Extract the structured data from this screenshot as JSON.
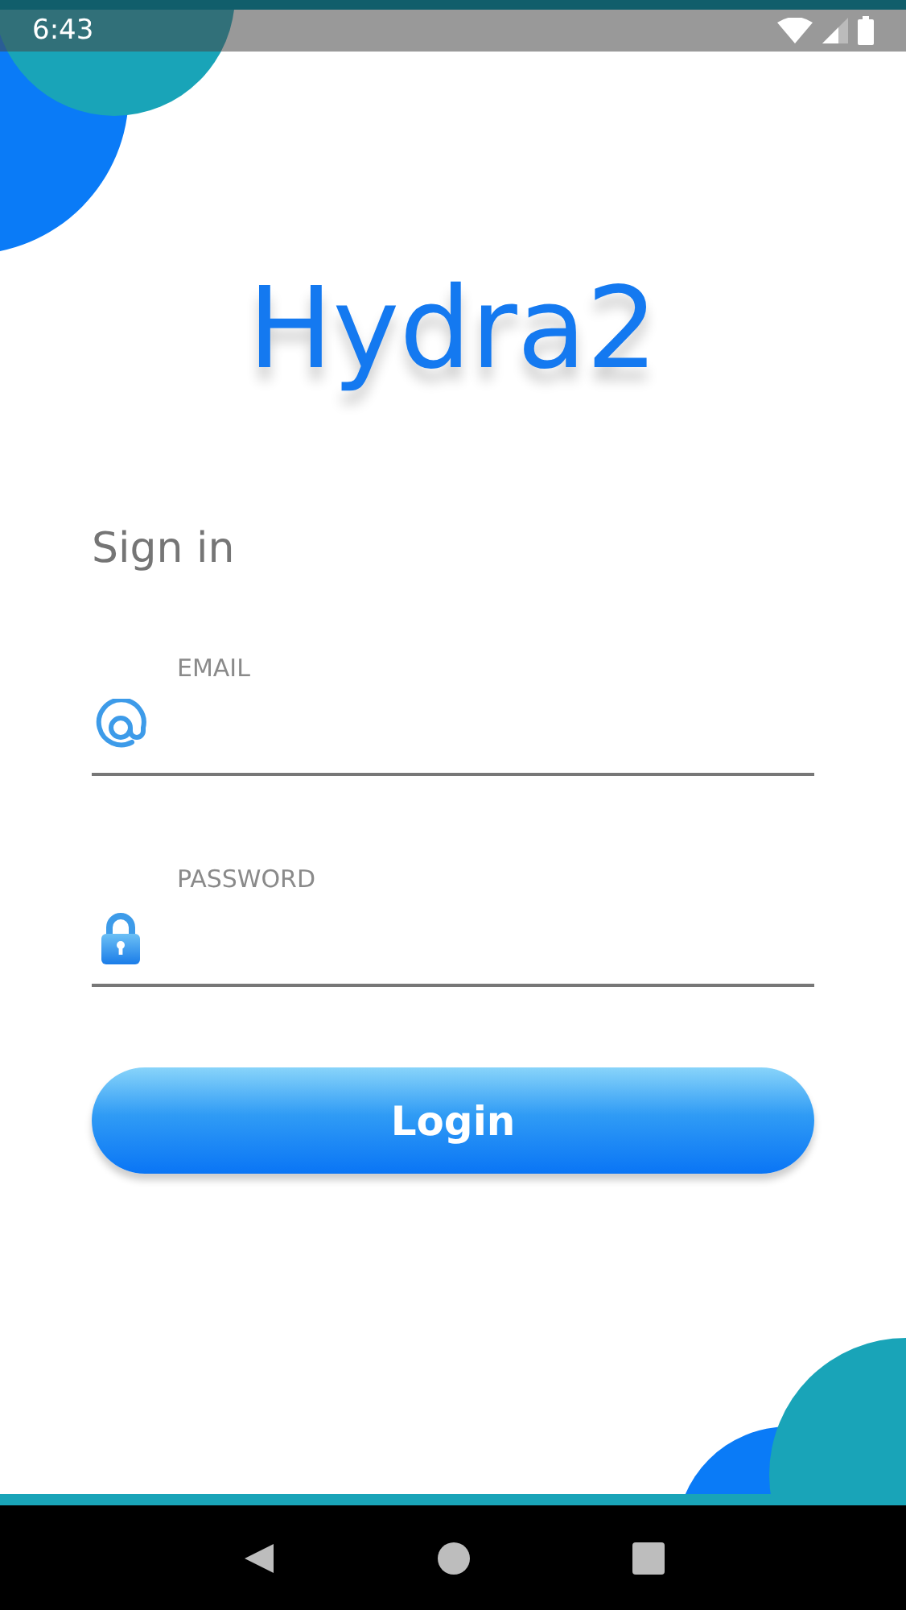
{
  "status_bar": {
    "time": "6:43"
  },
  "logo": "Hydra2",
  "heading": "Sign in",
  "fields": [
    {
      "kind": "email",
      "label": "EMAIL"
    },
    {
      "kind": "password",
      "label": "PASSWORD"
    }
  ],
  "button": "Login"
}
